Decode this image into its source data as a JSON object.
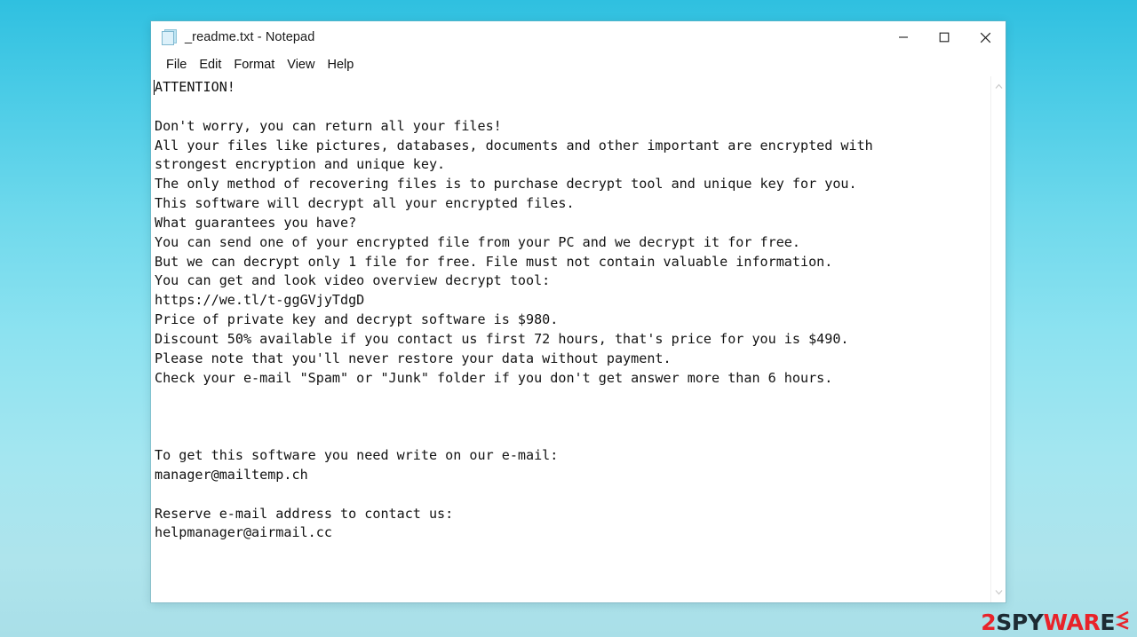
{
  "window": {
    "title": "_readme.txt - Notepad",
    "icon": "notepad-document-icon",
    "controls": {
      "minimize": "minimize-icon",
      "maximize": "maximize-icon",
      "close": "close-icon"
    }
  },
  "menu": {
    "items": [
      {
        "label": "File"
      },
      {
        "label": "Edit"
      },
      {
        "label": "Format"
      },
      {
        "label": "View"
      },
      {
        "label": "Help"
      }
    ]
  },
  "scrollbar": {
    "up_arrow": "chevron-up-icon",
    "down_arrow": "chevron-down-icon"
  },
  "document": {
    "filename": "_readme.txt",
    "lines": [
      "ATTENTION!",
      "",
      "Don't worry, you can return all your files!",
      "All your files like pictures, databases, documents and other important are encrypted with",
      "strongest encryption and unique key.",
      "The only method of recovering files is to purchase decrypt tool and unique key for you.",
      "This software will decrypt all your encrypted files.",
      "What guarantees you have?",
      "You can send one of your encrypted file from your PC and we decrypt it for free.",
      "But we can decrypt only 1 file for free. File must not contain valuable information.",
      "You can get and look video overview decrypt tool:",
      "https://we.tl/t-ggGVjyTdgD",
      "Price of private key and decrypt software is $980.",
      "Discount 50% available if you contact us first 72 hours, that's price for you is $490.",
      "Please note that you'll never restore your data without payment.",
      "Check your e-mail \"Spam\" or \"Junk\" folder if you don't get answer more than 6 hours.",
      "",
      "",
      "",
      "To get this software you need write on our e-mail:",
      "manager@mailtemp.ch",
      "",
      "Reserve e-mail address to contact us:",
      "helpmanager@airmail.cc"
    ],
    "text": "ATTENTION!\n\nDon't worry, you can return all your files!\nAll your files like pictures, databases, documents and other important are encrypted with\nstrongest encryption and unique key.\nThe only method of recovering files is to purchase decrypt tool and unique key for you.\nThis software will decrypt all your encrypted files.\nWhat guarantees you have?\nYou can send one of your encrypted file from your PC and we decrypt it for free.\nBut we can decrypt only 1 file for free. File must not contain valuable information.\nYou can get and look video overview decrypt tool:\nhttps://we.tl/t-ggGVjyTdgD\nPrice of private key and decrypt software is $980.\nDiscount 50% available if you contact us first 72 hours, that's price for you is $490.\nPlease note that you'll never restore your data without payment.\nCheck your e-mail \"Spam\" or \"Junk\" folder if you don't get answer more than 6 hours.\n\n\n\nTo get this software you need write on our e-mail:\nmanager@mailtemp.ch\n\nReserve e-mail address to contact us:\nhelpmanager@airmail.cc",
    "ransom_details": {
      "video_overview_url": "https://we.tl/t-ggGVjyTdgD",
      "price": "$980",
      "discounted_price": "$490",
      "discount_percent": "50%",
      "discount_window_hours": "72",
      "response_time_hours": "6",
      "free_decrypt_file_count": "1",
      "primary_email": "manager@mailtemp.ch",
      "reserve_email": "helpmanager@airmail.cc"
    }
  },
  "watermark": {
    "part1": "2",
    "part2": "SPY",
    "part3": "WAR",
    "part4": "E",
    "mark": "chevron-mark-icon",
    "red": "#e8232a",
    "dark": "#1d2b33"
  },
  "colors": {
    "background_top": "#2fc0e0",
    "background_bottom": "#a9dfe8",
    "window_background": "#ffffff",
    "text": "#121212"
  }
}
